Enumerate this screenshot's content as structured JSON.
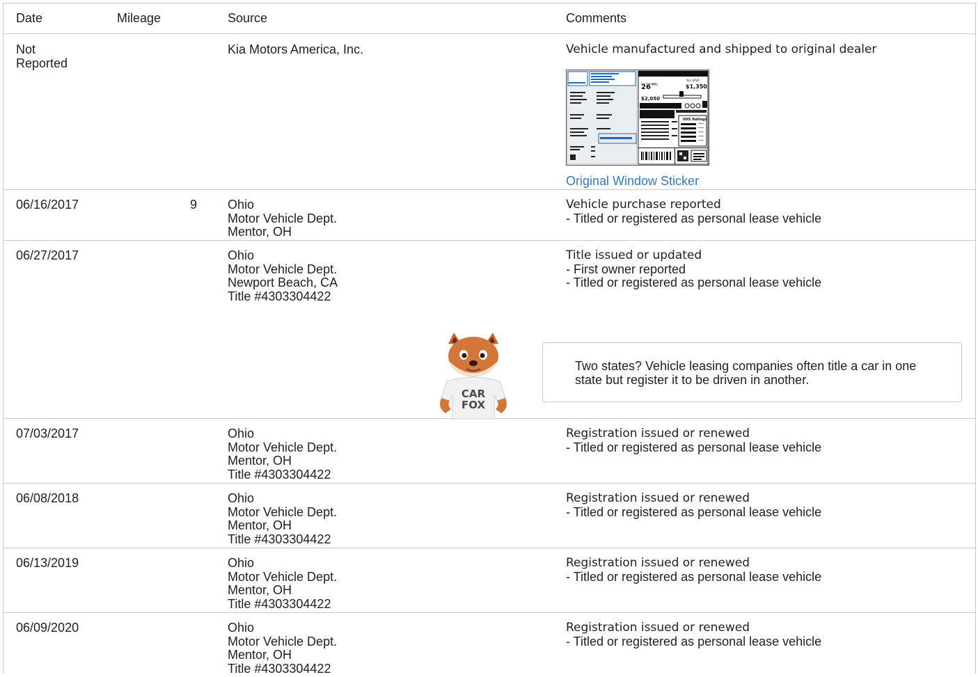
{
  "table": {
    "headers": {
      "date": "Date",
      "mileage": "Mileage",
      "source": "Source",
      "comments": "Comments"
    },
    "rows": [
      {
        "date": "Not Reported",
        "date_lines": [
          "Not",
          "Reported"
        ],
        "mileage": "",
        "source": [
          "Kia Motors America, Inc."
        ],
        "comment_title": "Vehicle manufactured and shipped to original dealer",
        "comment_items": [],
        "link": "Original Window Sticker"
      },
      {
        "date": "06/16/2017",
        "mileage": "9",
        "source": [
          "Ohio",
          "Motor Vehicle Dept.",
          "Mentor, OH"
        ],
        "comment_title": "Vehicle purchase reported",
        "comment_items": [
          "- Titled or registered as personal lease vehicle"
        ]
      },
      {
        "date": "06/27/2017",
        "mileage": "",
        "source": [
          "Ohio",
          "Motor Vehicle Dept.",
          "Newport Beach, CA",
          "Title #4303304422"
        ],
        "comment_title": "Title issued or updated",
        "comment_items": [
          "- First owner reported",
          "- Titled or registered as personal lease vehicle"
        ],
        "tip": "Two states? Vehicle leasing companies often title a car in one state but register it to be driven in another."
      },
      {
        "date": "07/03/2017",
        "mileage": "",
        "source": [
          "Ohio",
          "Motor Vehicle Dept.",
          "Mentor, OH",
          "Title #4303304422"
        ],
        "comment_title": "Registration issued or renewed",
        "comment_items": [
          "- Titled or registered as personal lease vehicle"
        ]
      },
      {
        "date": "06/08/2018",
        "mileage": "",
        "source": [
          "Ohio",
          "Motor Vehicle Dept.",
          "Mentor, OH",
          "Title #4303304422"
        ],
        "comment_title": "Registration issued or renewed",
        "comment_items": [
          "- Titled or registered as personal lease vehicle"
        ]
      },
      {
        "date": "06/13/2019",
        "mileage": "",
        "source": [
          "Ohio",
          "Motor Vehicle Dept.",
          "Mentor, OH",
          "Title #4303304422"
        ],
        "comment_title": "Registration issued or renewed",
        "comment_items": [
          "- Titled or registered as personal lease vehicle"
        ]
      },
      {
        "date": "06/09/2020",
        "mileage": "",
        "source": [
          "Ohio",
          "Motor Vehicle Dept.",
          "Mentor, OH",
          "Title #4303304422"
        ],
        "comment_title": "Registration issued or renewed",
        "comment_items": [
          "- Titled or registered as personal lease vehicle"
        ]
      }
    ]
  },
  "sticker": {
    "mpg": "26",
    "mpg_unit": "MPG",
    "save_amount": "$1,350",
    "fuel_cost": "$2,050",
    "ratings_label": "IIHS Ratings"
  },
  "mascot": {
    "shirt_line1": "CAR",
    "shirt_line2": "FOX"
  },
  "colors": {
    "border": "#c8c8c8",
    "link": "#3777bc",
    "text": "#212121"
  }
}
